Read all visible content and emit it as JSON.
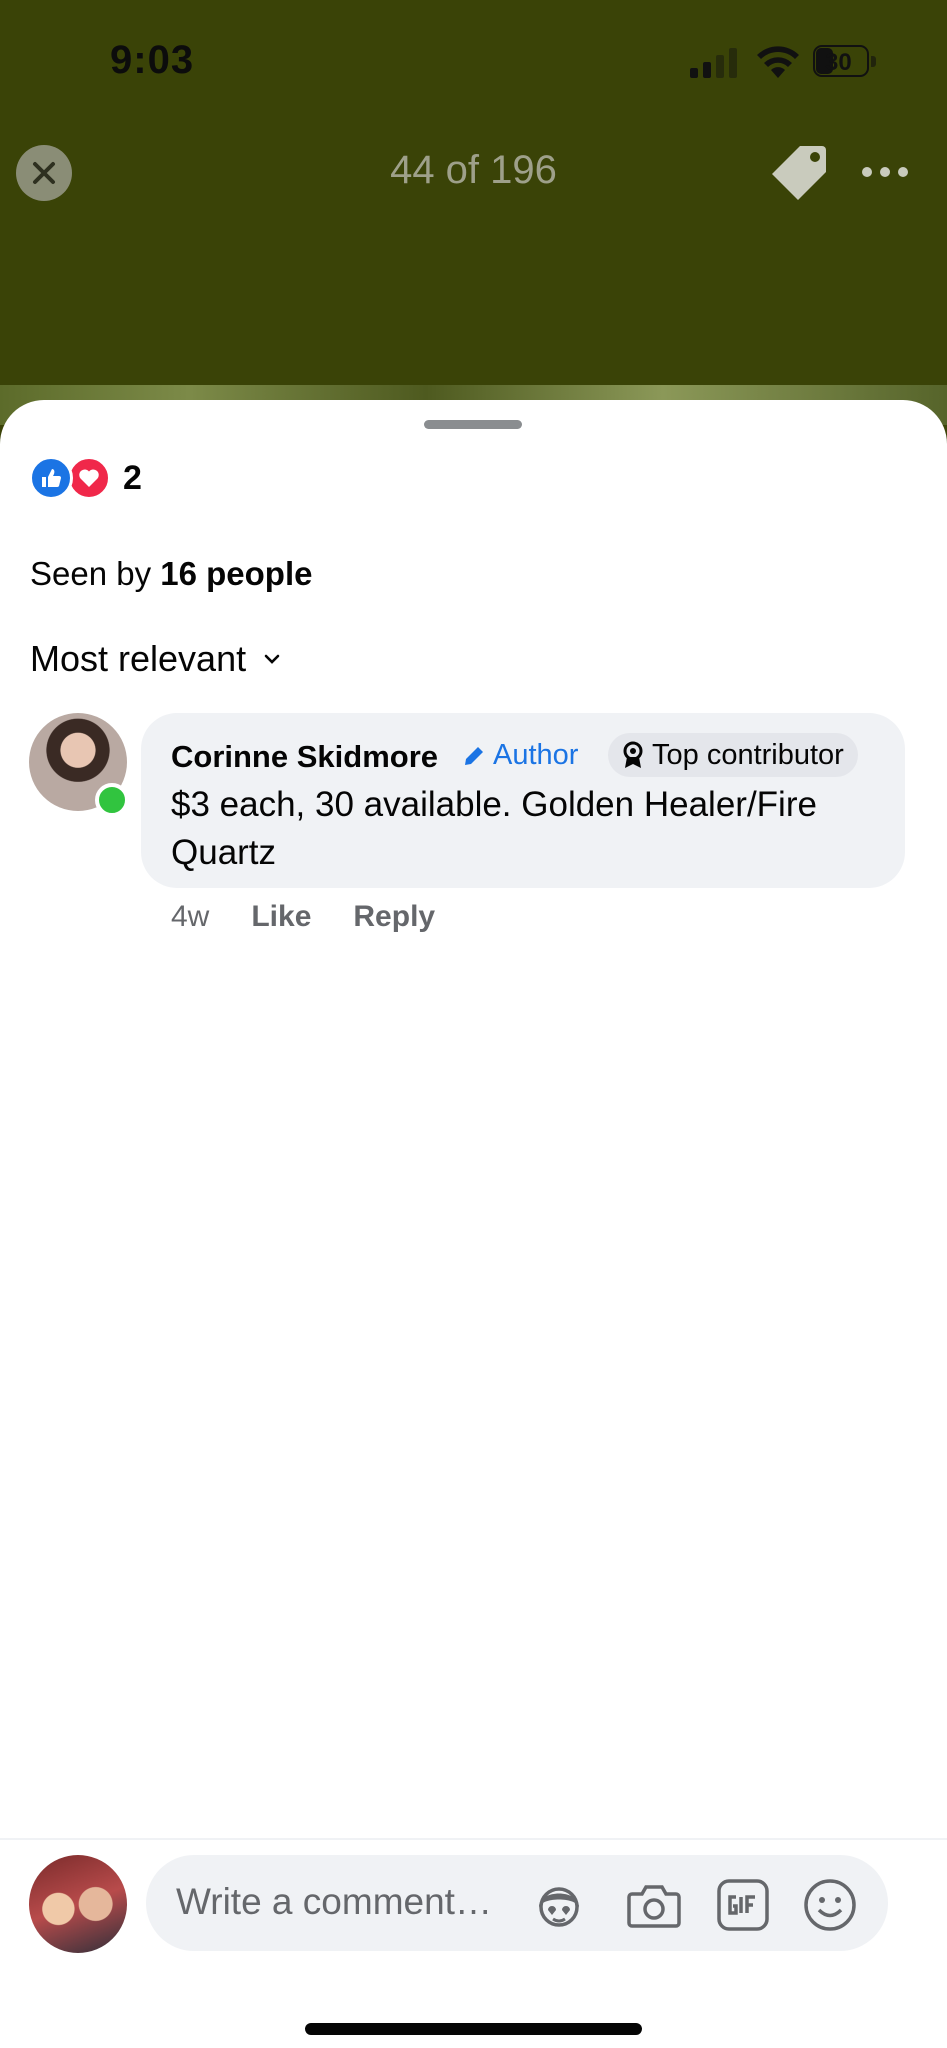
{
  "status_bar": {
    "time": "9:03",
    "battery": "30"
  },
  "viewer": {
    "counter": "44 of 196"
  },
  "reactions": {
    "count": "2",
    "types": [
      "like-icon",
      "love-icon"
    ]
  },
  "seen_by": {
    "prefix": "Seen by ",
    "count_text": "16 people"
  },
  "sort": {
    "label": "Most relevant"
  },
  "comment": {
    "author": "Corinne Skidmore",
    "author_badge": "Author",
    "contributor_badge": "Top contributor",
    "text": "$3 each, 30 available. Golden Healer/Fire Quartz",
    "age": "4w",
    "like_label": "Like",
    "reply_label": "Reply"
  },
  "composer": {
    "placeholder": "Write a comment…"
  },
  "colors": {
    "brand_blue": "#1b74e4",
    "love_red": "#f0284a",
    "online_green": "#31c43f"
  }
}
